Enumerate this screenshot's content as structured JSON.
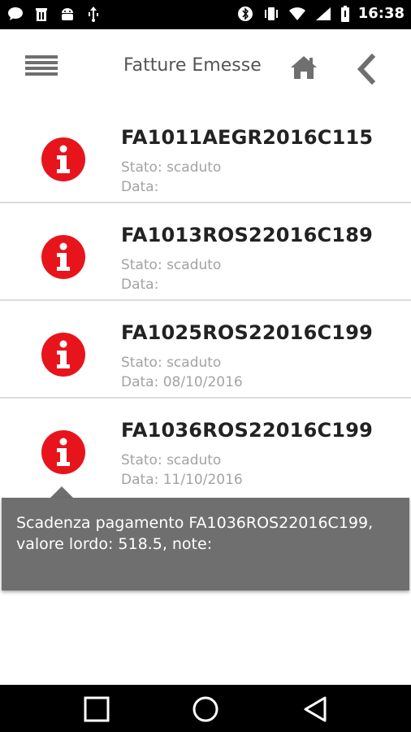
{
  "status_bar": {
    "time": "16:38",
    "left_icons": [
      "chat-bubble-icon",
      "trash-icon",
      "android-icon",
      "usb-icon"
    ],
    "right_icons": [
      "bluetooth-icon",
      "vibrate-icon",
      "wifi-icon",
      "signal-icon",
      "battery-icon"
    ]
  },
  "app_bar": {
    "title": "Fatture Emesse",
    "menu_icon": "hamburger-menu-icon",
    "home_icon": "home-icon",
    "back_icon": "chevron-left-icon"
  },
  "invoices": [
    {
      "code": "FA1011AEGR2016C115",
      "stato": "Stato: scaduto",
      "data": "Data:"
    },
    {
      "code": "FA1013ROS22016C189",
      "stato": "Stato: scaduto",
      "data": "Data:"
    },
    {
      "code": "FA1025ROS22016C199",
      "stato": "Stato: scaduto",
      "data": "Data: 08/10/2016"
    },
    {
      "code": "FA1036ROS22016C199",
      "stato": "Stato: scaduto",
      "data": "Data: 11/10/2016"
    }
  ],
  "tooltip": {
    "text": "Scadenza pagamento FA1036ROS22016C199, valore lordo: 518.5, note:"
  },
  "colors": {
    "accent_red": "#e8141c",
    "tooltip_bg": "#6f6f6f",
    "muted_text": "#a3a3a3"
  },
  "nav_bar": {
    "icons": [
      "recents-square-icon",
      "home-circle-icon",
      "back-triangle-icon"
    ]
  }
}
